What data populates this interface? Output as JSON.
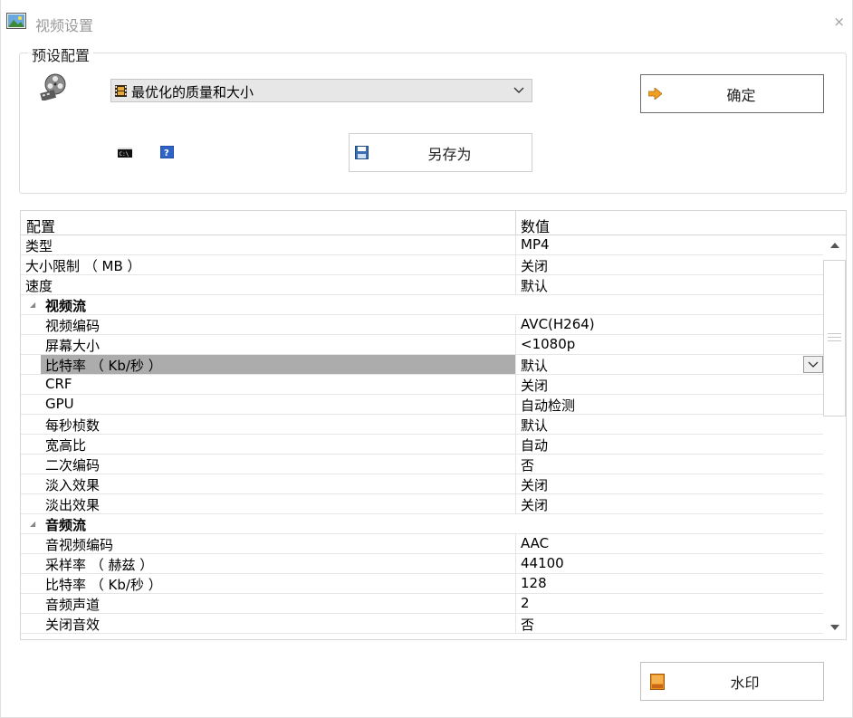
{
  "window": {
    "title": "视频设置",
    "close_glyph": "×"
  },
  "preset": {
    "group_label": "预设配置",
    "selected": "最优化的质量和大小",
    "ok_label": "确定",
    "save_as_label": "另存为"
  },
  "grid": {
    "header_name": "配置",
    "header_value": "数值",
    "rows": [
      {
        "name": "类型",
        "value": "MP4"
      },
      {
        "name": "大小限制 （ MB ）",
        "value": "关闭"
      },
      {
        "name": "速度",
        "value": "默认"
      },
      {
        "name": "视频流",
        "value": ""
      },
      {
        "name": "视频编码",
        "value": "AVC(H264)"
      },
      {
        "name": "屏幕大小",
        "value": "<1080p"
      },
      {
        "name": "比特率 （ Kb/秒 ）",
        "value": "默认"
      },
      {
        "name": "CRF",
        "value": "关闭"
      },
      {
        "name": "GPU",
        "value": "自动检测"
      },
      {
        "name": "每秒桢数",
        "value": "默认"
      },
      {
        "name": "宽高比",
        "value": "自动"
      },
      {
        "name": "二次编码",
        "value": "否"
      },
      {
        "name": "淡入效果",
        "value": "关闭"
      },
      {
        "name": "淡出效果",
        "value": "关闭"
      },
      {
        "name": "音频流",
        "value": ""
      },
      {
        "name": "音视频编码",
        "value": "AAC"
      },
      {
        "name": "采样率 （ 赫兹 ）",
        "value": "44100"
      },
      {
        "name": "比特率 （ Kb/秒 ）",
        "value": "128"
      },
      {
        "name": "音频声道",
        "value": "2"
      },
      {
        "name": "关闭音效",
        "value": "否"
      }
    ]
  },
  "watermark_label": "水印",
  "colors": {
    "selected_row": "#acacac",
    "ok_arrow": "#f0a020"
  },
  "icons": {
    "app": "picture-icon",
    "film": "film-reel-icon",
    "cmd": "console-icon",
    "help": "help-icon",
    "save": "floppy-disk-icon",
    "ok": "arrow-right-icon",
    "watermark": "watermark-icon"
  }
}
